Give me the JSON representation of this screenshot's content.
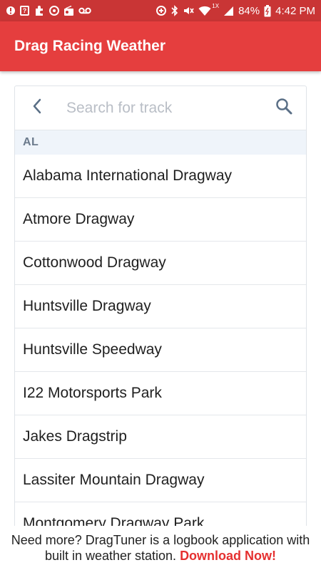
{
  "status_bar": {
    "left_icons": [
      "alert-icon",
      "unknown-box-icon",
      "puzzle-icon",
      "target-icon",
      "radio-icon",
      "voicemail-icon"
    ],
    "right_icons": [
      "data-saver-icon",
      "bluetooth-icon",
      "mute-icon",
      "wifi-icon",
      "signal-icon",
      "battery-icon"
    ],
    "network_label": "1X",
    "battery": "84%",
    "time": "4:42 PM"
  },
  "app_bar": {
    "title": "Drag Racing Weather",
    "color": "#e53e3e"
  },
  "search": {
    "placeholder": "Search for track",
    "value": ""
  },
  "section": {
    "label": "AL"
  },
  "tracks": [
    "Alabama International Dragway",
    "Atmore Dragway",
    "Cottonwood Dragway",
    "Huntsville Dragway",
    "Huntsville Speedway",
    "I22 Motorsports Park",
    "Jakes Dragstrip",
    "Lassiter Mountain Dragway",
    "Montgomery Dragway Park"
  ],
  "footer": {
    "text": "Need more? DragTuner is a logbook application with built in weather station.",
    "link": "Download Now!",
    "link_color": "#e53030"
  }
}
